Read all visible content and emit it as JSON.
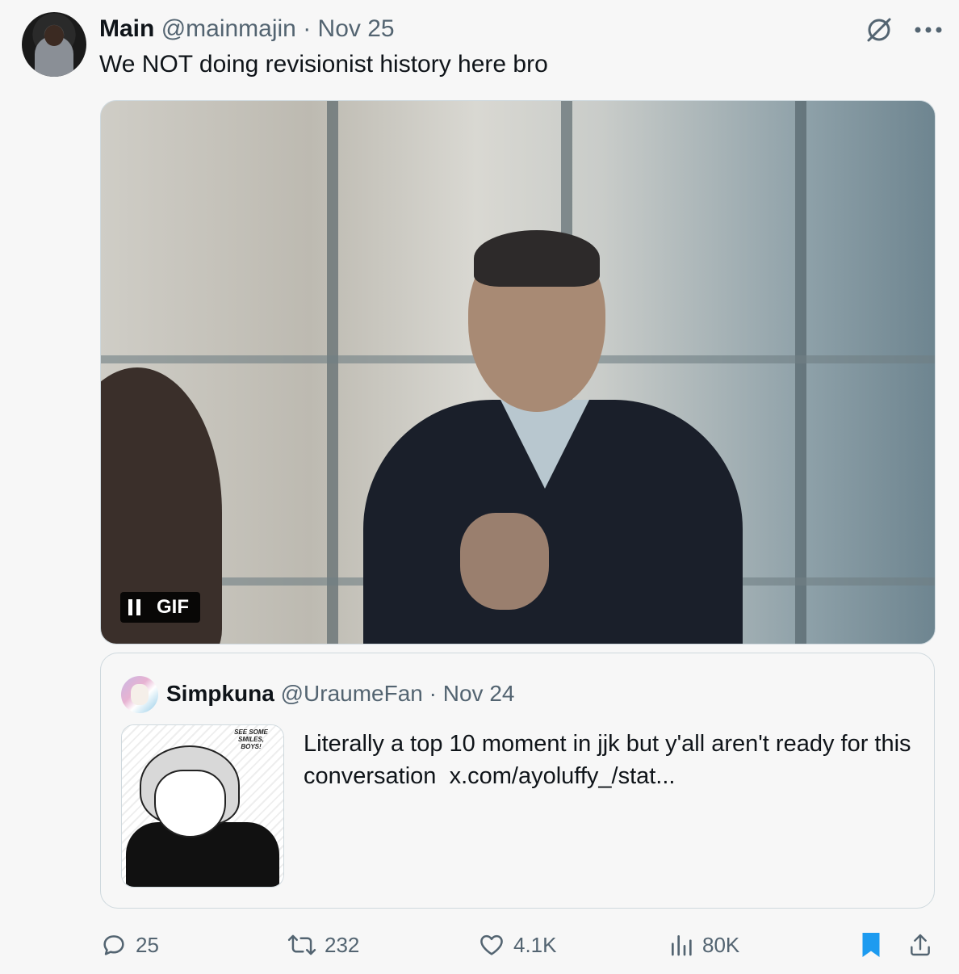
{
  "tweet": {
    "author_name": "Main",
    "author_handle": "@mainmajin",
    "separator": "·",
    "date": "Nov 25",
    "text": "We NOT doing revisionist history here bro"
  },
  "media": {
    "badge_label": "GIF"
  },
  "quoted_tweet": {
    "author_name": "Simpkuna",
    "author_handle": "@UraumeFan",
    "separator": "·",
    "date": "Nov 24",
    "text": "Literally a top 10 moment in jjk but y'all aren't ready for this conversation",
    "link": "x.com/ayoluffy_/stat...",
    "thumbnail_caption": "SEE SOME SMILES, BOYS!"
  },
  "actions": {
    "replies": "25",
    "reposts": "232",
    "likes": "4.1K",
    "views": "80K"
  },
  "colors": {
    "secondary_text": "#536471",
    "primary_text": "#0f1419",
    "bookmark_active": "#1d9bf0"
  },
  "icons": [
    "grok-icon",
    "more-icon",
    "pause-icon",
    "reply-icon",
    "repost-icon",
    "like-icon",
    "views-icon",
    "bookmark-icon",
    "share-icon"
  ]
}
